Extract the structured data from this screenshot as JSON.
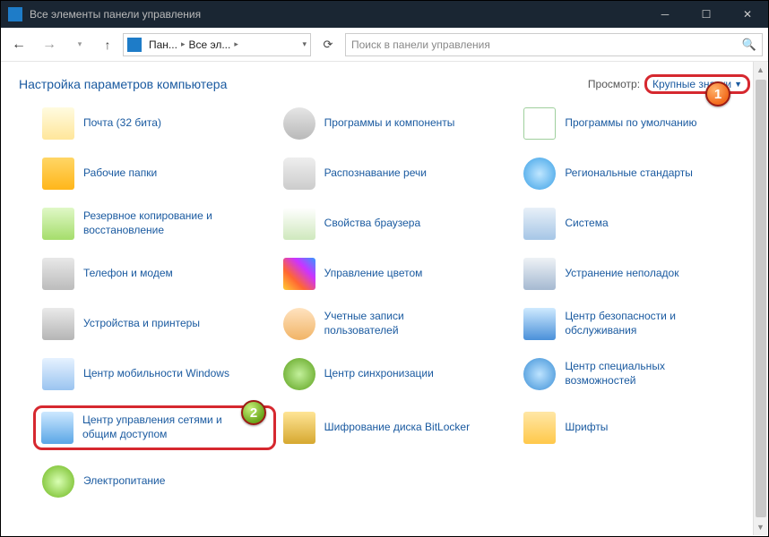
{
  "titlebar": {
    "title": "Все элементы панели управления"
  },
  "breadcrumb": {
    "root": "Пан...",
    "current": "Все эл..."
  },
  "search": {
    "placeholder": "Поиск в панели управления"
  },
  "header": {
    "heading": "Настройка параметров компьютера",
    "view_label": "Просмотр:",
    "view_value": "Крупные значки"
  },
  "callouts": {
    "one": "1",
    "two": "2"
  },
  "items": [
    {
      "id": "mail",
      "label": "Почта (32 бита)",
      "icon": "ico-mail"
    },
    {
      "id": "programs-features",
      "label": "Программы и компоненты",
      "icon": "ico-programs"
    },
    {
      "id": "default-programs",
      "label": "Программы по умолчанию",
      "icon": "ico-defaults"
    },
    {
      "id": "work-folders",
      "label": "Рабочие папки",
      "icon": "ico-folder"
    },
    {
      "id": "speech-recognition",
      "label": "Распознавание речи",
      "icon": "ico-mic"
    },
    {
      "id": "region",
      "label": "Региональные стандарты",
      "icon": "ico-globe"
    },
    {
      "id": "backup-restore",
      "label": "Резервное копирование и восстановление",
      "icon": "ico-backup"
    },
    {
      "id": "internet-options",
      "label": "Свойства браузера",
      "icon": "ico-browser"
    },
    {
      "id": "system",
      "label": "Система",
      "icon": "ico-system"
    },
    {
      "id": "phone-modem",
      "label": "Телефон и модем",
      "icon": "ico-phone"
    },
    {
      "id": "color-management",
      "label": "Управление цветом",
      "icon": "ico-color"
    },
    {
      "id": "troubleshooting",
      "label": "Устранение неполадок",
      "icon": "ico-fix"
    },
    {
      "id": "devices-printers",
      "label": "Устройства и принтеры",
      "icon": "ico-printer"
    },
    {
      "id": "user-accounts",
      "label": "Учетные записи пользователей",
      "icon": "ico-users"
    },
    {
      "id": "security-maintenance",
      "label": "Центр безопасности и обслуживания",
      "icon": "ico-security"
    },
    {
      "id": "mobility-center",
      "label": "Центр мобильности Windows",
      "icon": "ico-mobility"
    },
    {
      "id": "sync-center",
      "label": "Центр синхронизации",
      "icon": "ico-sync"
    },
    {
      "id": "ease-of-access",
      "label": "Центр специальных возможностей",
      "icon": "ico-access"
    },
    {
      "id": "network-sharing",
      "label": "Центр управления сетями и общим доступом",
      "icon": "ico-network",
      "highlight": true
    },
    {
      "id": "bitlocker",
      "label": "Шифрование диска BitLocker",
      "icon": "ico-bitlocker"
    },
    {
      "id": "fonts",
      "label": "Шрифты",
      "icon": "ico-fonts"
    },
    {
      "id": "power-options",
      "label": "Электропитание",
      "icon": "ico-power"
    }
  ]
}
